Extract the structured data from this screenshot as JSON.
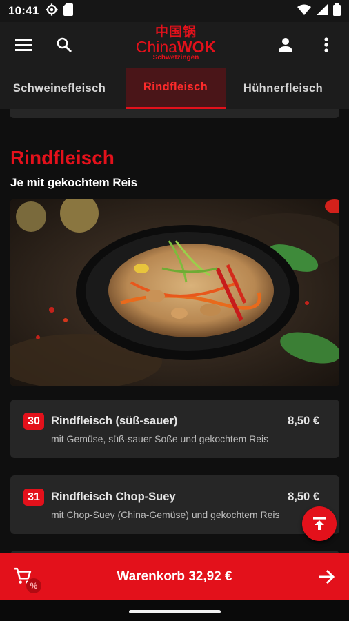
{
  "status_bar": {
    "time": "10:41"
  },
  "header": {
    "logo_chinese": "中国锅",
    "logo_china": "China",
    "logo_wok": "WOK",
    "logo_city": "Schwetzingen"
  },
  "tabs": [
    {
      "label": "Schweinefleisch",
      "active": false
    },
    {
      "label": "Rindfleisch",
      "active": true
    },
    {
      "label": "Hühnerfleisch",
      "active": false
    }
  ],
  "section": {
    "title": "Rindfleisch",
    "subtitle": "Je mit gekochtem Reis"
  },
  "items": [
    {
      "number": "30",
      "name": "Rindfleisch (süß-sauer)",
      "price": "8,50 €",
      "description": "mit Gemüse, süß-sauer Soße und gekochtem Reis"
    },
    {
      "number": "31",
      "name": "Rindfleisch Chop-Suey",
      "price": "8,50 €",
      "description": "mit Chop-Suey (China-Gemüse) und gekochtem Reis"
    }
  ],
  "cart": {
    "label": "Warenkorb 32,92 €",
    "badge": "%"
  },
  "colors": {
    "accent": "#e3111b",
    "background": "#0f0f0f",
    "card": "#262626"
  }
}
